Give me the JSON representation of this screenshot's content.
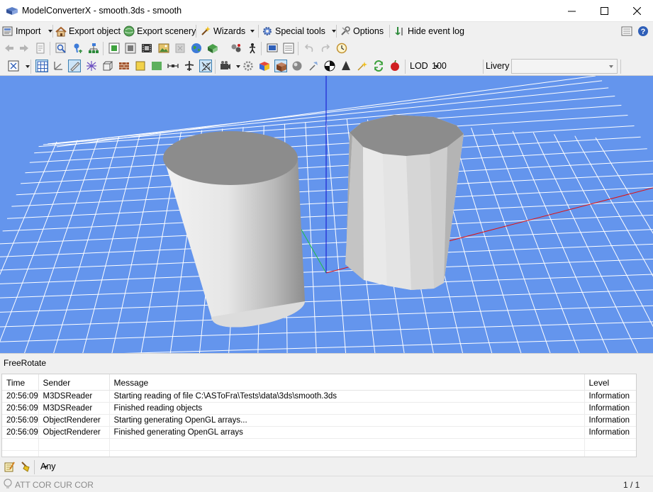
{
  "window": {
    "title": "ModelConverterX - smooth.3ds - smooth"
  },
  "menubar": {
    "import": "Import",
    "export_object": "Export object",
    "export_scenery": "Export scenery",
    "wizards": "Wizards",
    "special_tools": "Special tools",
    "options": "Options",
    "hide_event_log": "Hide event log"
  },
  "toolbar3": {
    "lod_label": "LOD",
    "lod_value": "100",
    "livery_label": "Livery",
    "livery_value": ""
  },
  "mode": {
    "label": "FreeRotate"
  },
  "log": {
    "columns": [
      "Time",
      "Sender",
      "Message",
      "Level"
    ],
    "rows": [
      [
        "20:56:09",
        "M3DSReader",
        "Starting reading of file C:\\ASToFra\\Tests\\data\\3ds\\smooth.3ds",
        "Information"
      ],
      [
        "20:56:09",
        "M3DSReader",
        "Finished reading objects",
        "Information"
      ],
      [
        "20:56:09",
        "ObjectRenderer",
        "Starting generating OpenGL arrays...",
        "Information"
      ],
      [
        "20:56:09",
        "ObjectRenderer",
        "Finished generating OpenGL arrays",
        "Information"
      ]
    ]
  },
  "filter": {
    "value": "Any"
  },
  "status": {
    "att_cor": "ATT COR  CUR COR",
    "page": "1 / 1"
  },
  "colors": {
    "viewport_bg": "#6495ed",
    "grid": "#ffffff",
    "axis_x": "#e01010",
    "axis_y": "#1010d0",
    "axis_z": "#20c040"
  }
}
